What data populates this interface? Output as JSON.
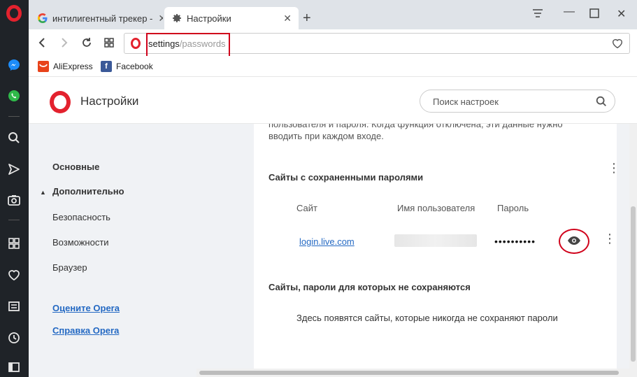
{
  "sidebar": {
    "icons": [
      "opera-logo-icon",
      "messenger-icon",
      "whatsapp-icon",
      "search-icon",
      "send-icon",
      "camera-icon",
      "speed-dial-icon",
      "heart-icon",
      "news-icon",
      "history-icon",
      "sidebar-toggle-icon"
    ]
  },
  "tabs": [
    {
      "label": "интилигентный трекер - ",
      "icon": "google-icon",
      "active": false
    },
    {
      "label": "Настройки",
      "icon": "gear-icon",
      "active": true
    }
  ],
  "address": {
    "url_main": "settings",
    "url_path": "/passwords"
  },
  "bookmarks": [
    {
      "label": "AliExpress",
      "icon": "aliexpress-icon",
      "color": "#e8431b"
    },
    {
      "label": "Facebook",
      "icon": "facebook-icon",
      "color": "#3b5998"
    }
  ],
  "header": {
    "title": "Настройки",
    "search_placeholder": "Поиск настроек"
  },
  "nav": {
    "basic": "Основные",
    "advanced": "Дополнительно",
    "security": "Безопасность",
    "features": "Возможности",
    "browser": "Браузер",
    "rate": "Оцените Opera",
    "help": "Справка Opera"
  },
  "content": {
    "cut_text": "пользователя и пароля. Когда функция отключена, эти данные нужно вводить при каждом входе.",
    "saved_title": "Сайты с сохраненными паролями",
    "col_site": "Сайт",
    "col_user": "Имя пользователя",
    "col_password": "Пароль",
    "row_site": "login.live.com",
    "row_password": "••••••••••",
    "never_title": "Сайты, пароли для которых не сохраняются",
    "never_msg": "Здесь появятся сайты, которые никогда не сохраняют пароли"
  },
  "colors": {
    "opera_red": "#e3222e",
    "link_blue": "#2469c3",
    "highlight_red": "#d0021b"
  }
}
